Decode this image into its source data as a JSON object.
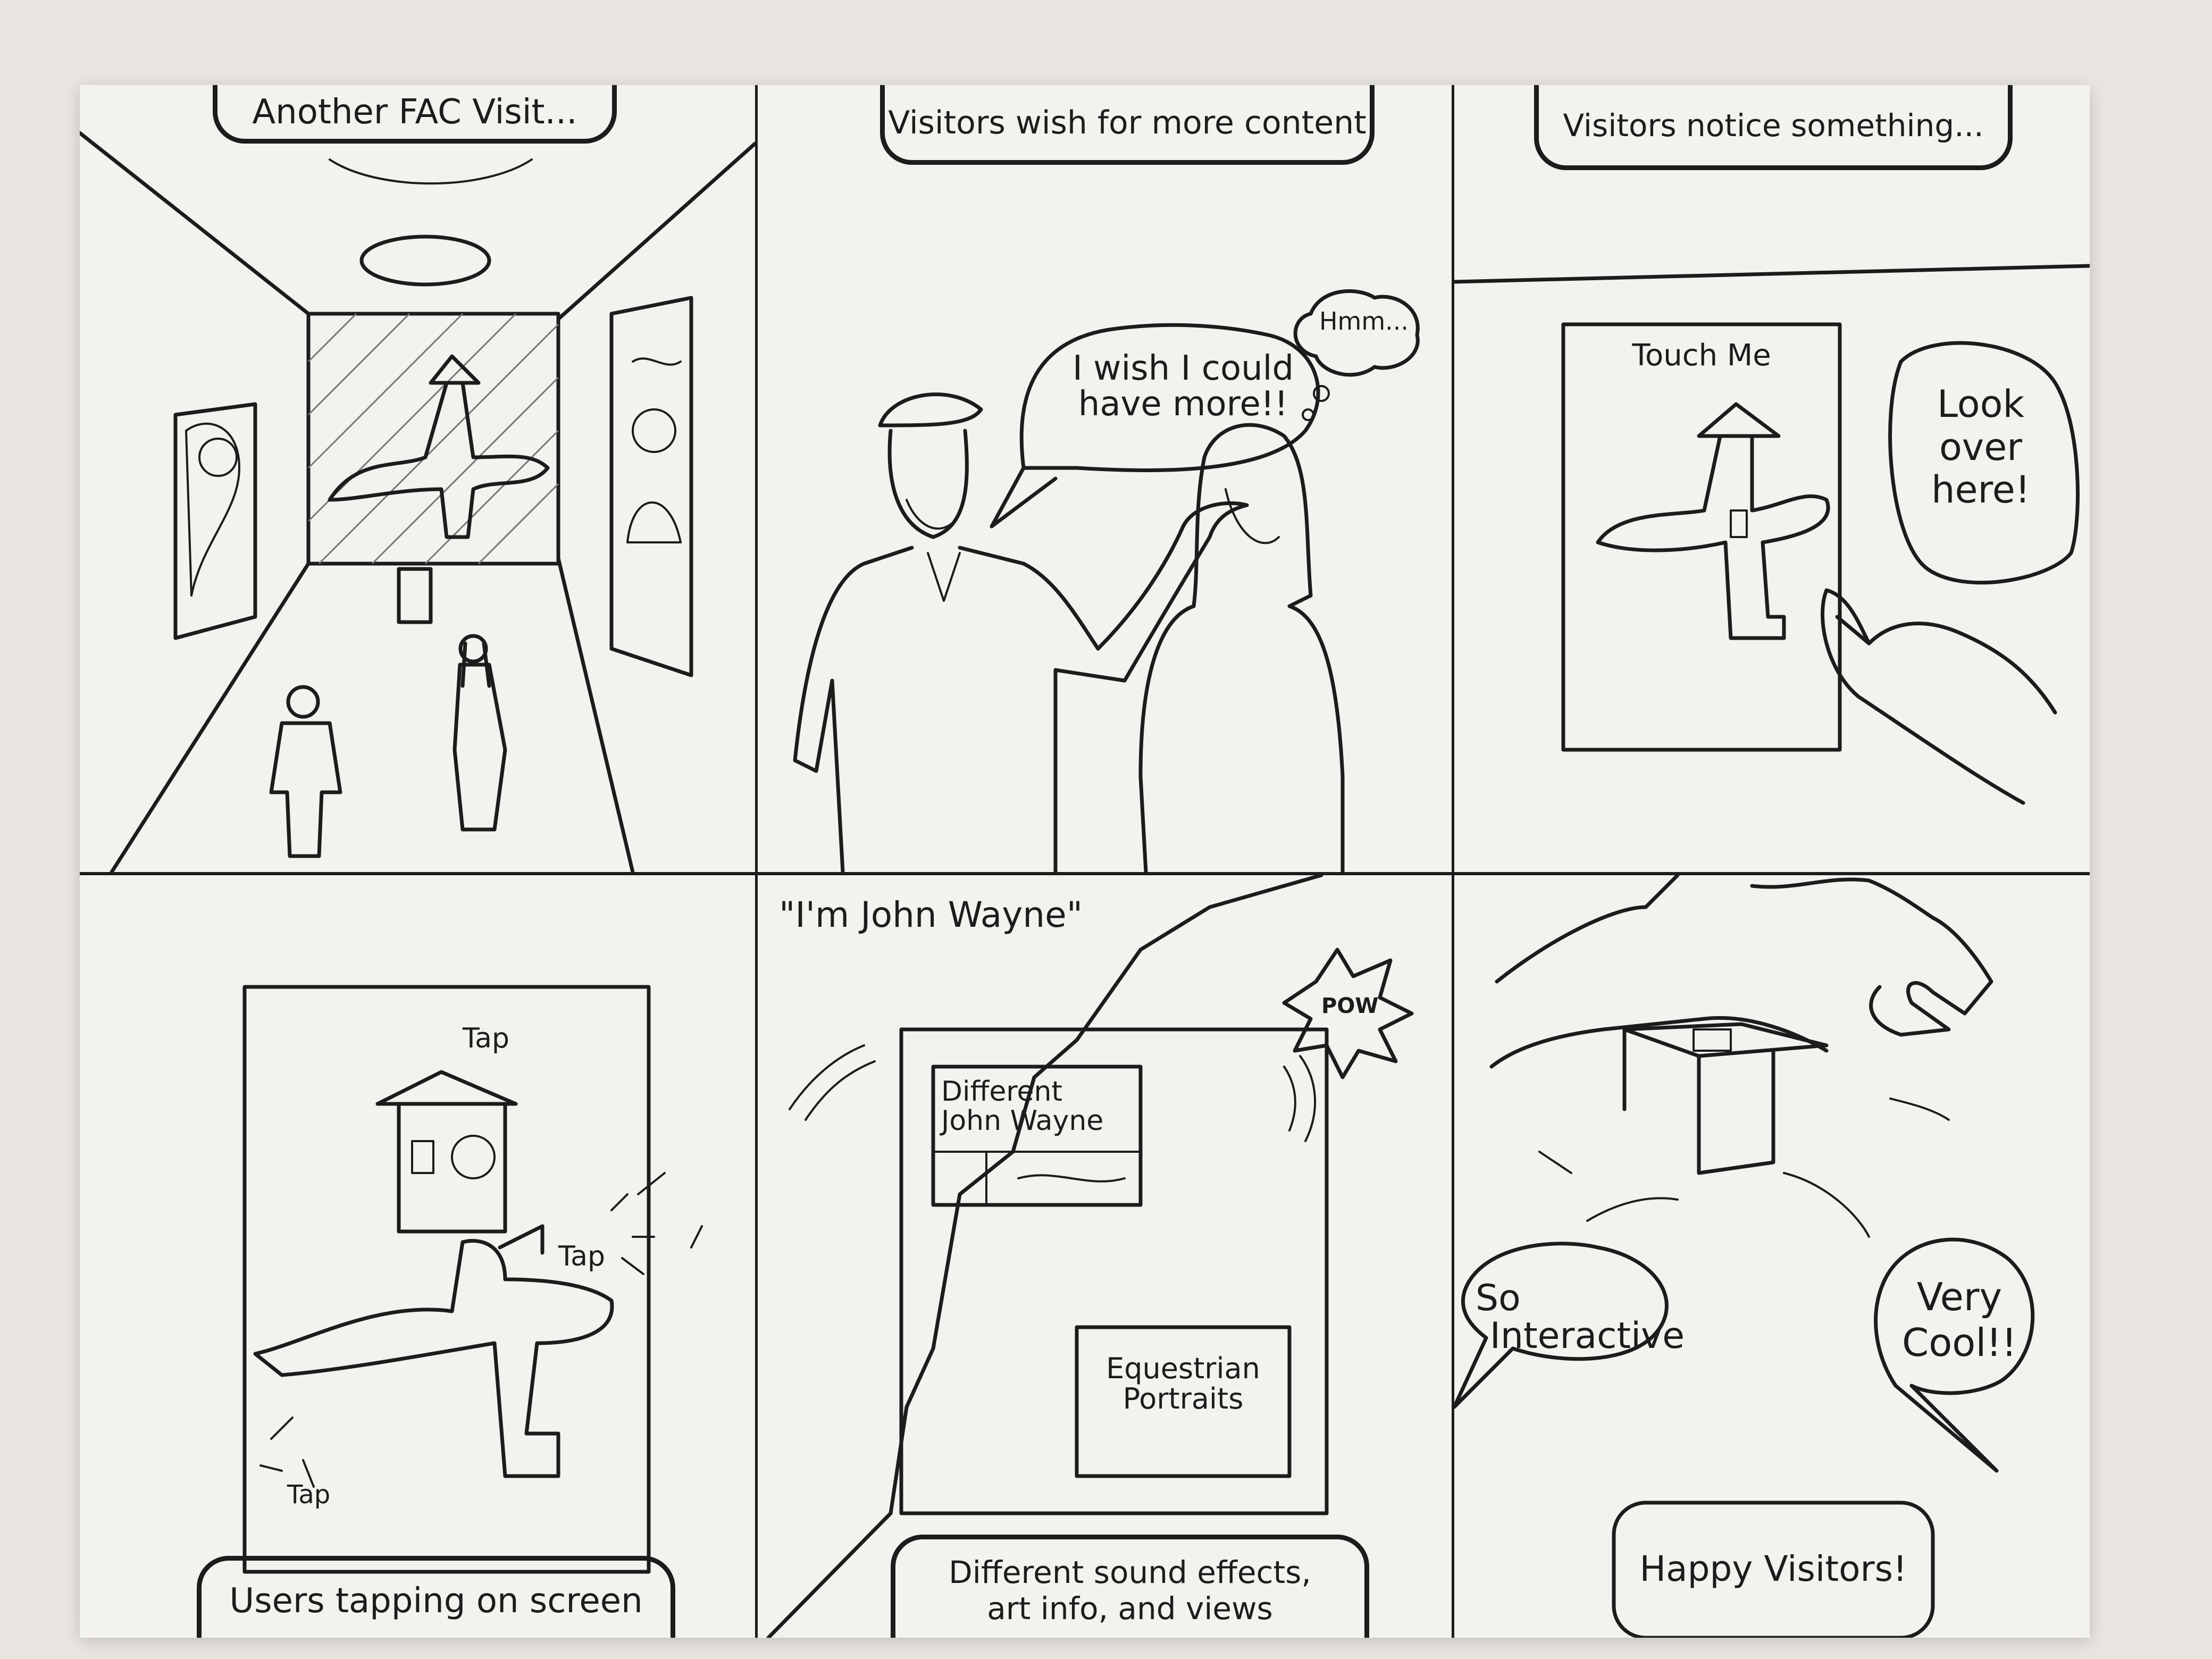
{
  "panels": {
    "p1": {
      "caption": "Another FAC Visit..."
    },
    "p2": {
      "caption": "Visitors wish for more content",
      "speech": [
        "I wish I could",
        "have more!!"
      ],
      "thought": "Hmm..."
    },
    "p3": {
      "caption": "Visitors notice something...",
      "screen_label": "Touch Me",
      "speech": [
        "Look",
        "over",
        "here!"
      ]
    },
    "p4": {
      "caption": "Users tapping on screen",
      "tap_labels": [
        "Tap",
        "Tap",
        "Tap"
      ]
    },
    "p5": {
      "quote": "\"I'm John Wayne\"",
      "pow": "POW",
      "card1": [
        "Different",
        "John Wayne"
      ],
      "card2": [
        "Equestrian",
        "Portraits"
      ],
      "caption": [
        "Different sound effects,",
        "art info, and views"
      ]
    },
    "p6": {
      "speech1": [
        "So",
        "Interactive"
      ],
      "speech2": [
        "Very",
        "Cool!!"
      ],
      "caption": "Happy Visitors!"
    }
  }
}
